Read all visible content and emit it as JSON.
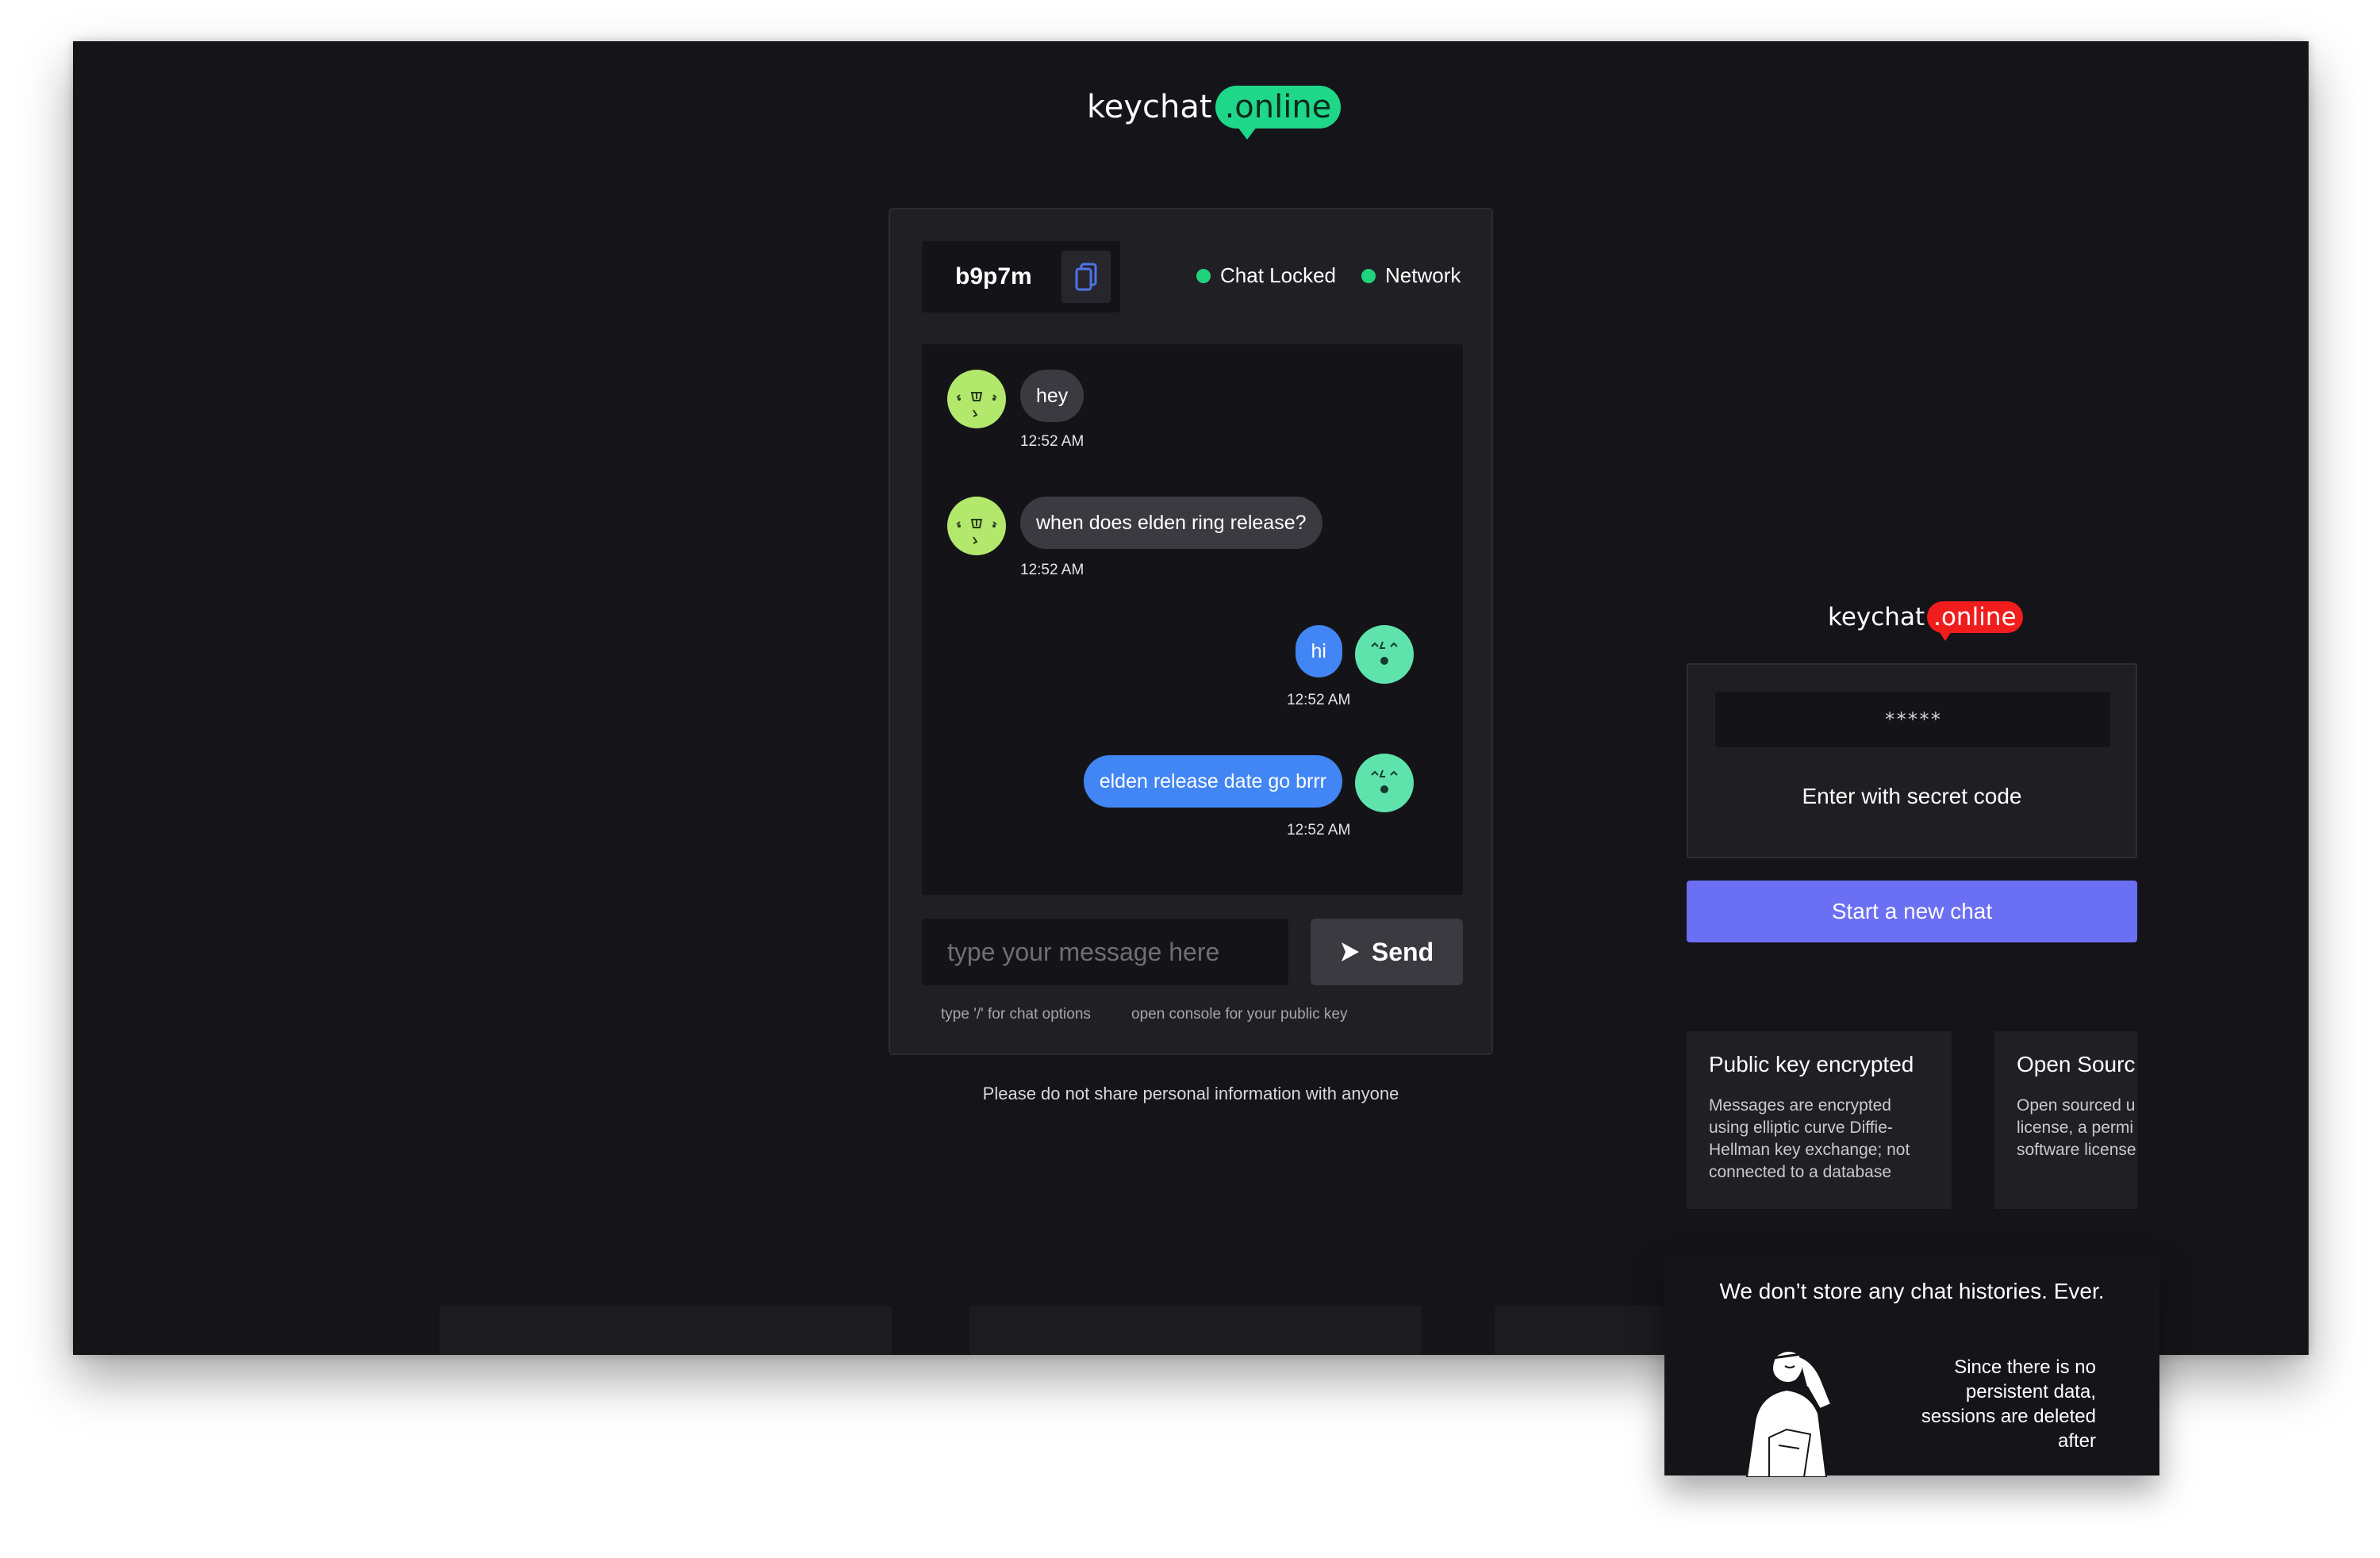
{
  "brand": {
    "name": "keychat",
    "tld": ".online"
  },
  "chat": {
    "room_code": "b9p7m",
    "status_locked": "Chat Locked",
    "status_network": "Network",
    "messages": [
      {
        "side": "incoming",
        "text": "hey",
        "time": "12:52 AM"
      },
      {
        "side": "incoming",
        "text": "when does elden ring release?",
        "time": "12:52 AM"
      },
      {
        "side": "outgoing",
        "text": "hi",
        "time": "12:52 AM"
      },
      {
        "side": "outgoing",
        "text": "elden release date go brrr",
        "time": "12:52 AM"
      }
    ],
    "input_placeholder": "type your message here",
    "send_label": "Send",
    "hint_options": "type '/' for chat options",
    "hint_console": "open console for your public key"
  },
  "disclaimer": "Please do not share personal information with anyone",
  "landing": {
    "secret_placeholder": "*****",
    "enter_label": "Enter with secret code",
    "start_label": "Start a new chat",
    "features": [
      {
        "title": "Public key encrypted",
        "body": "Messages are encrypted using elliptic curve Diffie-Hellman key exchange; not connected to a database"
      },
      {
        "title": "Open Sourc",
        "body_lines": [
          "Open sourced u",
          "license, a permi",
          "software license"
        ]
      }
    ],
    "history_title": "We don’t store any chat histories. Ever.",
    "history_text": "Since there is no persistent data, sessions are deleted after"
  },
  "colors": {
    "background": "#141419",
    "accent_green": "#1ed789",
    "status_green": "#21d27d",
    "outgoing_bubble": "#4285f4",
    "incoming_bubble": "#3a3a40",
    "start_button": "#6a6ff3",
    "badge_red": "#f11c1c"
  }
}
